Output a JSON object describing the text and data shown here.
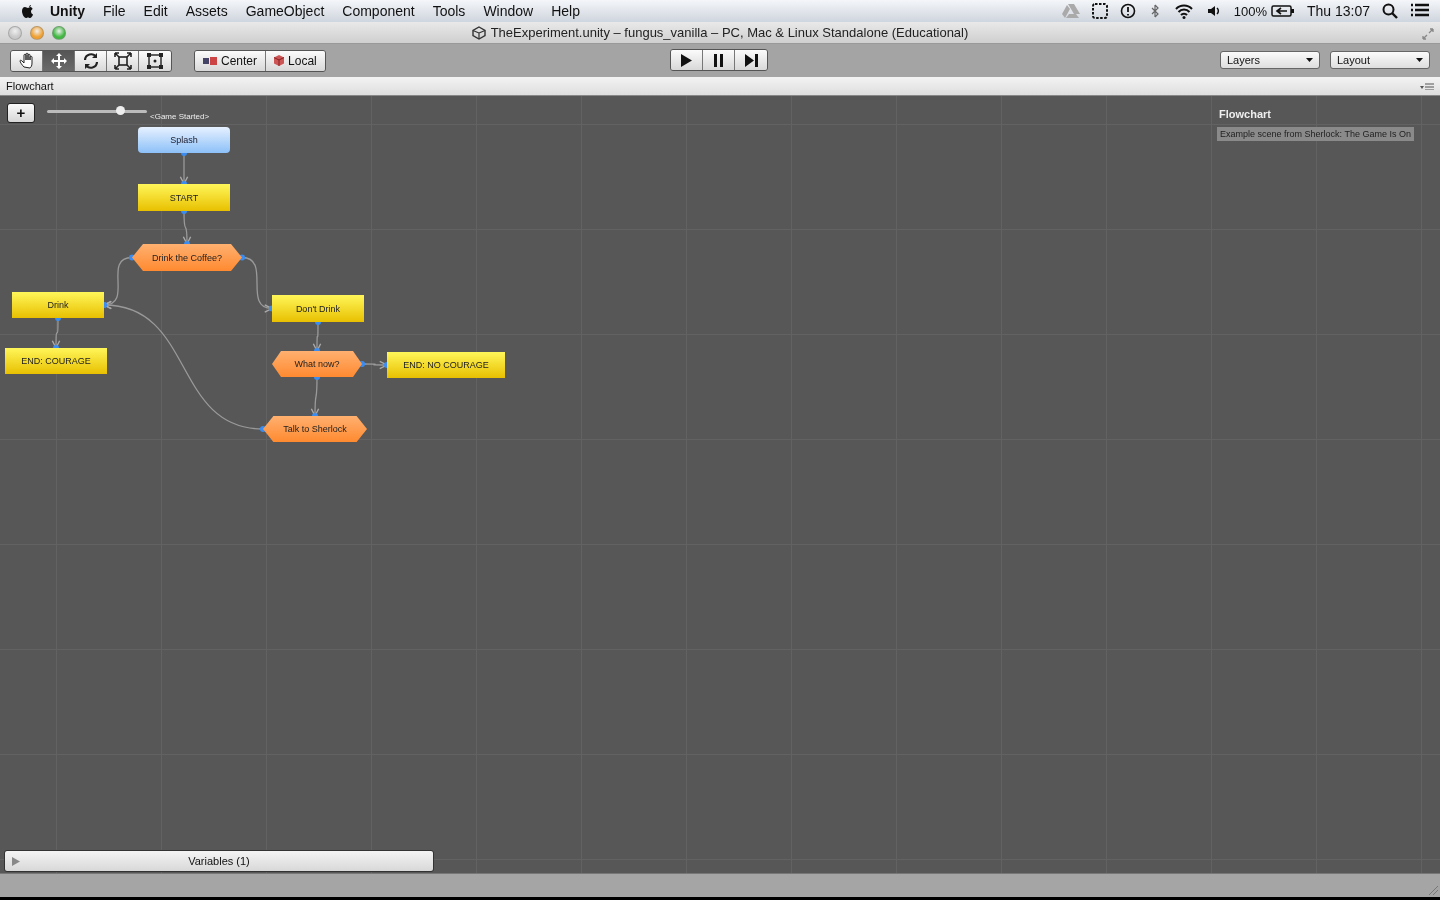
{
  "menubar": {
    "app_name": "Unity",
    "menus": [
      "File",
      "Edit",
      "Assets",
      "GameObject",
      "Component",
      "Tools",
      "Window",
      "Help"
    ],
    "battery": "100%",
    "clock": "Thu 13:07"
  },
  "window": {
    "title": "TheExperiment.unity – fungus_vanilla – PC, Mac & Linux Standalone (Educational)"
  },
  "toolbar": {
    "tools": [
      {
        "kind": "hand",
        "selected": false
      },
      {
        "kind": "move",
        "selected": true
      },
      {
        "kind": "rotate",
        "selected": false
      },
      {
        "kind": "scale",
        "selected": false
      },
      {
        "kind": "rect",
        "selected": false
      }
    ],
    "pivot_buttons": [
      "Center",
      "Local"
    ],
    "dropdowns": [
      "Layers",
      "Layout"
    ]
  },
  "tab": {
    "label": "Flowchart"
  },
  "flowchart": {
    "add_button": "+",
    "zoom": {
      "level": 0.74
    },
    "start_label": "<Game Started>",
    "blocks": [
      {
        "label": "Splash",
        "kind": "event"
      },
      {
        "label": "START",
        "kind": "block"
      },
      {
        "label": "Drink the Coffee?",
        "kind": "choice"
      },
      {
        "label": "Drink",
        "kind": "block"
      },
      {
        "label": "Don't Drink",
        "kind": "block"
      },
      {
        "label": "END: COURAGE",
        "kind": "block"
      },
      {
        "label": "What now?",
        "kind": "choice"
      },
      {
        "label": "END: NO COURAGE",
        "kind": "block"
      },
      {
        "label": "Talk to Sherlock",
        "kind": "choice"
      }
    ],
    "info": {
      "title": "Flowchart",
      "description": "Example scene from Sherlock: The Game Is On"
    },
    "variables": {
      "label": "Variables (1)",
      "expanded": false
    }
  }
}
